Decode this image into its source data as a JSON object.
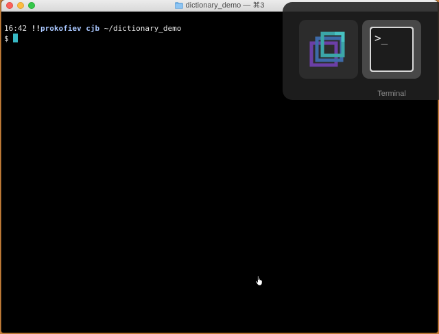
{
  "window": {
    "title": "dictionary_demo — ⌘3"
  },
  "terminal": {
    "time": "16:42",
    "history_marker": "!!",
    "host": "prokofiev",
    "user": "cjb",
    "cwd": "~/dictionary_demo",
    "prompt_symbol": "$"
  },
  "app_switcher": {
    "apps": [
      {
        "icon": "stacked-windows-icon",
        "label": ""
      },
      {
        "icon": "terminal-app-icon",
        "label": "Terminal"
      }
    ],
    "selected_label": "Terminal"
  },
  "colors": {
    "terminal_bg": "#000000",
    "cursor": "#37b8c4",
    "prompt_user": "#a9c7ff"
  }
}
